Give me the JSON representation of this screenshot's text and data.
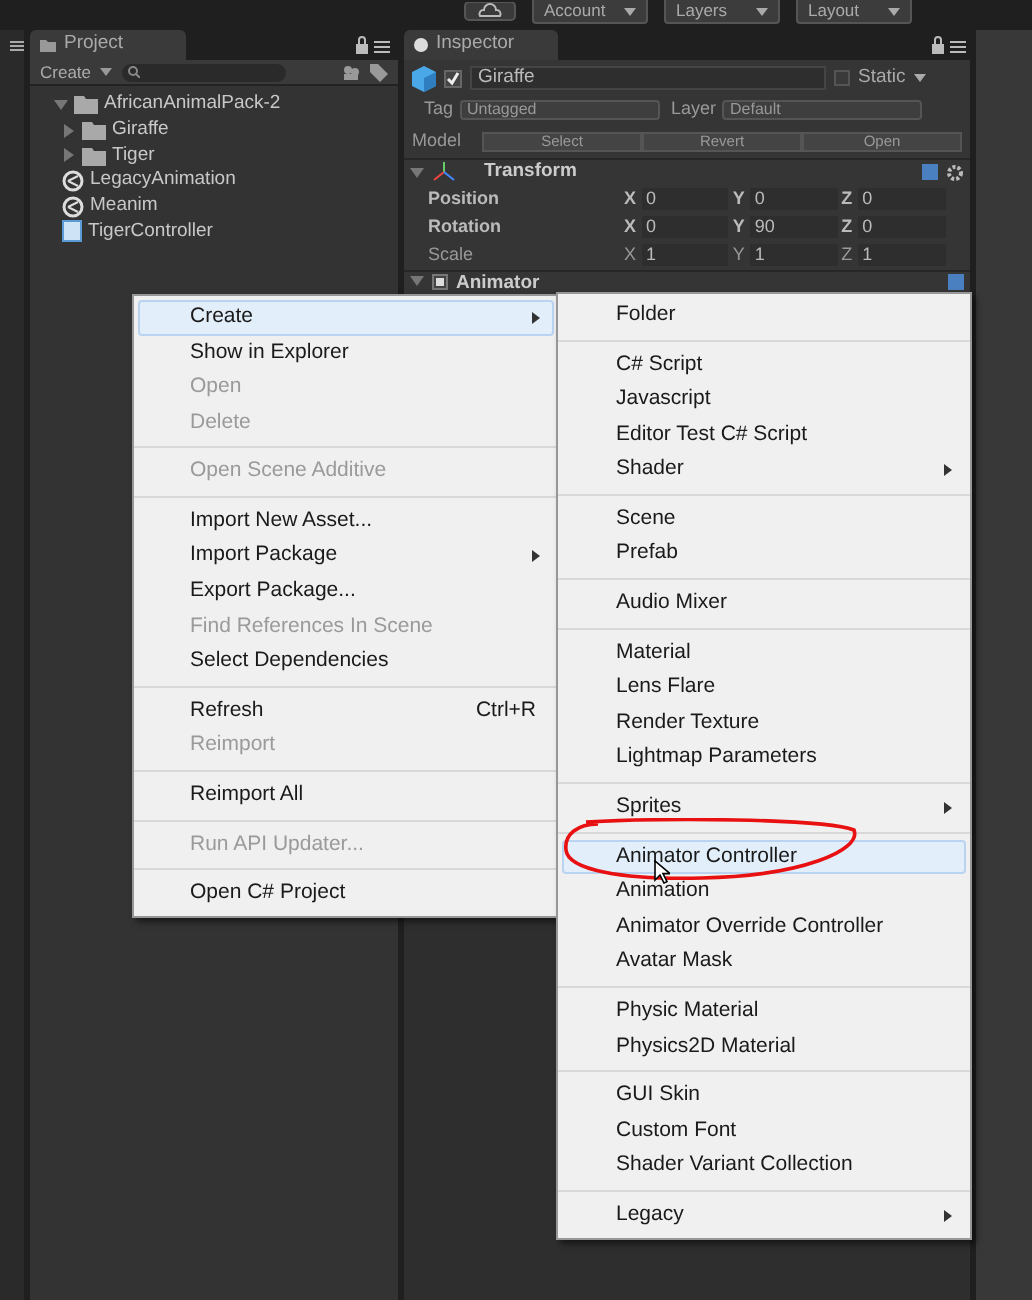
{
  "toolbar": {
    "buttons": [
      {
        "label": "Account"
      },
      {
        "label": "Layers"
      },
      {
        "label": "Layout"
      }
    ]
  },
  "project": {
    "tab": "Project",
    "create": "Create",
    "tree": [
      {
        "label": "AfricanAnimalPack-2",
        "kind": "folder",
        "expanded": true,
        "children": [
          {
            "label": "Giraffe",
            "kind": "folder",
            "expanded": false
          },
          {
            "label": "Tiger",
            "kind": "folder",
            "expanded": false
          },
          {
            "label": "LegacyAnimation",
            "kind": "model"
          },
          {
            "label": "Meanim",
            "kind": "model"
          },
          {
            "label": "TigerController",
            "kind": "script"
          }
        ]
      }
    ]
  },
  "inspector": {
    "tab": "Inspector",
    "active": true,
    "name": "Giraffe",
    "static_label": "Static",
    "static": false,
    "tag_label": "Tag",
    "tag": "Untagged",
    "layer_label": "Layer",
    "layer": "Default",
    "model_label": "Model",
    "model_buttons": [
      "Select",
      "Revert",
      "Open"
    ],
    "transform": {
      "title": "Transform",
      "expanded": true,
      "rows": [
        {
          "label": "Position",
          "modified": true,
          "values": [
            {
              "axis": "X",
              "value": "0"
            },
            {
              "axis": "Y",
              "value": "0"
            },
            {
              "axis": "Z",
              "value": "0"
            }
          ]
        },
        {
          "label": "Rotation",
          "modified": true,
          "values": [
            {
              "axis": "X",
              "value": "0"
            },
            {
              "axis": "Y",
              "value": "90"
            },
            {
              "axis": "Z",
              "value": "0"
            }
          ]
        },
        {
          "label": "Scale",
          "modified": false,
          "values": [
            {
              "axis": "X",
              "value": "1"
            },
            {
              "axis": "Y",
              "value": "1"
            },
            {
              "axis": "Z",
              "value": "1"
            }
          ]
        }
      ]
    },
    "animator": {
      "title": "Animator",
      "enabled": true
    }
  },
  "context_menu": {
    "items": [
      {
        "kind": "item",
        "label": "Create",
        "disabled": false,
        "submenu": true,
        "selected": true
      },
      {
        "kind": "item",
        "label": "Show in Explorer",
        "disabled": false,
        "submenu": false,
        "selected": false
      },
      {
        "kind": "item",
        "label": "Open",
        "disabled": true,
        "submenu": false,
        "selected": false
      },
      {
        "kind": "item",
        "label": "Delete",
        "disabled": true,
        "submenu": false,
        "selected": false
      },
      {
        "kind": "separator"
      },
      {
        "kind": "item",
        "label": "Open Scene Additive",
        "disabled": true,
        "submenu": false,
        "selected": false
      },
      {
        "kind": "separator"
      },
      {
        "kind": "item",
        "label": "Import New Asset...",
        "disabled": false,
        "submenu": false,
        "selected": false
      },
      {
        "kind": "item",
        "label": "Import Package",
        "disabled": false,
        "submenu": true,
        "selected": false
      },
      {
        "kind": "item",
        "label": "Export Package...",
        "disabled": false,
        "submenu": false,
        "selected": false
      },
      {
        "kind": "item",
        "label": "Find References In Scene",
        "disabled": true,
        "submenu": false,
        "selected": false
      },
      {
        "kind": "item",
        "label": "Select Dependencies",
        "disabled": false,
        "submenu": false,
        "selected": false
      },
      {
        "kind": "separator"
      },
      {
        "kind": "item",
        "label": "Refresh",
        "shortcut": "Ctrl+R",
        "disabled": false,
        "submenu": false,
        "selected": false
      },
      {
        "kind": "item",
        "label": "Reimport",
        "disabled": true,
        "submenu": false,
        "selected": false
      },
      {
        "kind": "separator"
      },
      {
        "kind": "item",
        "label": "Reimport All",
        "disabled": false,
        "submenu": false,
        "selected": false
      },
      {
        "kind": "separator"
      },
      {
        "kind": "item",
        "label": "Run API Updater...",
        "disabled": true,
        "submenu": false,
        "selected": false
      },
      {
        "kind": "separator"
      },
      {
        "kind": "item",
        "label": "Open C# Project",
        "disabled": false,
        "submenu": false,
        "selected": false
      }
    ]
  },
  "create_submenu": {
    "items": [
      {
        "kind": "item",
        "label": "Folder",
        "submenu": false,
        "selected": false
      },
      {
        "kind": "separator"
      },
      {
        "kind": "item",
        "label": "C# Script",
        "submenu": false,
        "selected": false
      },
      {
        "kind": "item",
        "label": "Javascript",
        "submenu": false,
        "selected": false
      },
      {
        "kind": "item",
        "label": "Editor Test C# Script",
        "submenu": false,
        "selected": false
      },
      {
        "kind": "item",
        "label": "Shader",
        "submenu": true,
        "selected": false
      },
      {
        "kind": "separator"
      },
      {
        "kind": "item",
        "label": "Scene",
        "submenu": false,
        "selected": false
      },
      {
        "kind": "item",
        "label": "Prefab",
        "submenu": false,
        "selected": false
      },
      {
        "kind": "separator"
      },
      {
        "kind": "item",
        "label": "Audio Mixer",
        "submenu": false,
        "selected": false
      },
      {
        "kind": "separator"
      },
      {
        "kind": "item",
        "label": "Material",
        "submenu": false,
        "selected": false
      },
      {
        "kind": "item",
        "label": "Lens Flare",
        "submenu": false,
        "selected": false
      },
      {
        "kind": "item",
        "label": "Render Texture",
        "submenu": false,
        "selected": false
      },
      {
        "kind": "item",
        "label": "Lightmap Parameters",
        "submenu": false,
        "selected": false
      },
      {
        "kind": "separator"
      },
      {
        "kind": "item",
        "label": "Sprites",
        "submenu": true,
        "selected": false
      },
      {
        "kind": "separator"
      },
      {
        "kind": "item",
        "label": "Animator Controller",
        "submenu": false,
        "selected": true,
        "circled": true
      },
      {
        "kind": "item",
        "label": "Animation",
        "submenu": false,
        "selected": false
      },
      {
        "kind": "item",
        "label": "Animator Override Controller",
        "submenu": false,
        "selected": false
      },
      {
        "kind": "item",
        "label": "Avatar Mask",
        "submenu": false,
        "selected": false
      },
      {
        "kind": "separator"
      },
      {
        "kind": "item",
        "label": "Physic Material",
        "submenu": false,
        "selected": false
      },
      {
        "kind": "item",
        "label": "Physics2D Material",
        "submenu": false,
        "selected": false
      },
      {
        "kind": "separator"
      },
      {
        "kind": "item",
        "label": "GUI Skin",
        "submenu": false,
        "selected": false
      },
      {
        "kind": "item",
        "label": "Custom Font",
        "submenu": false,
        "selected": false
      },
      {
        "kind": "item",
        "label": "Shader Variant Collection",
        "submenu": false,
        "selected": false
      },
      {
        "kind": "separator"
      },
      {
        "kind": "item",
        "label": "Legacy",
        "submenu": true,
        "selected": false
      }
    ]
  }
}
